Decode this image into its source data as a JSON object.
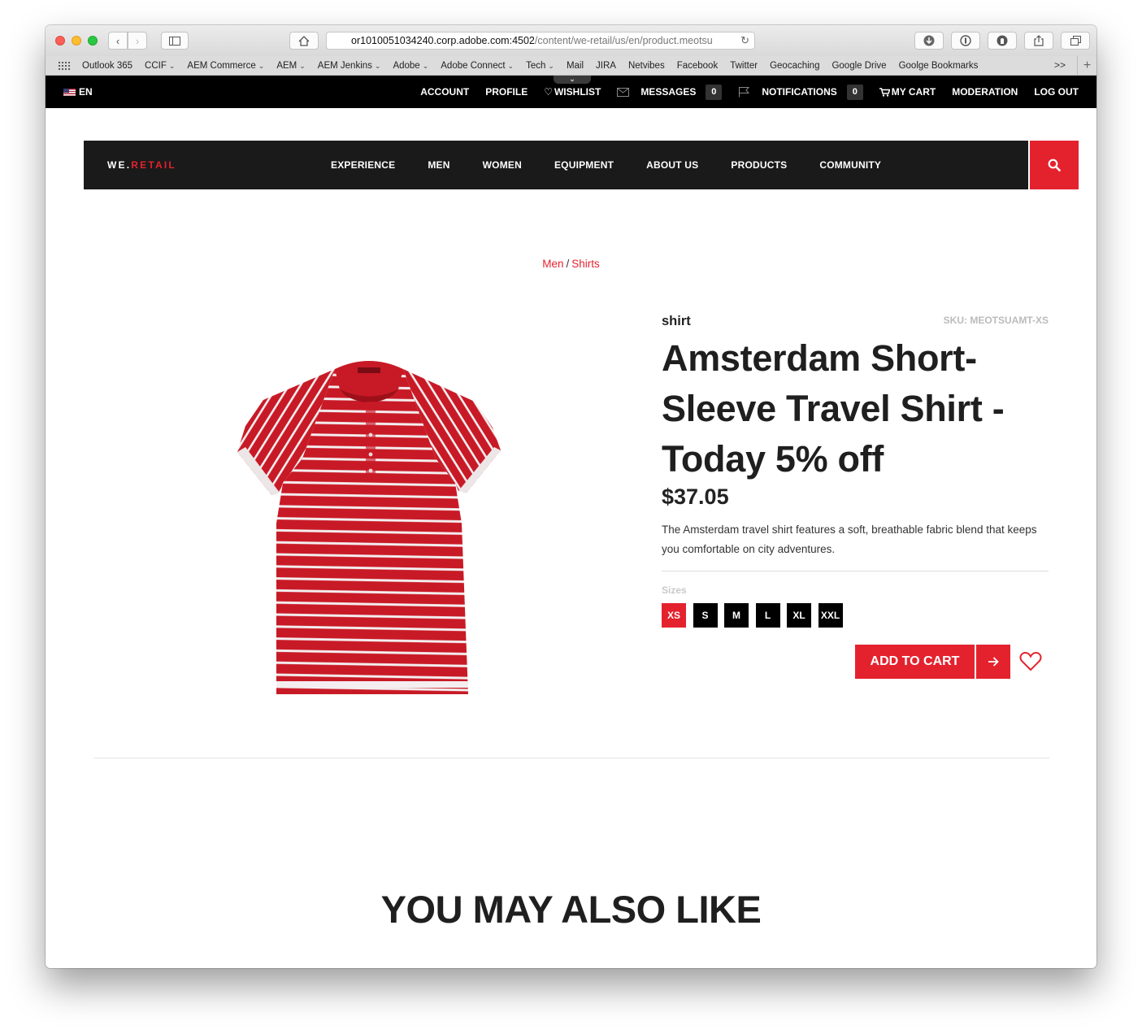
{
  "browser": {
    "url_host": "or1010051034240.corp.adobe.com:4502",
    "url_path": "/content/we-retail/us/en/product.meotsu",
    "bookmarks": [
      {
        "label": "Outlook 365",
        "has_menu": false
      },
      {
        "label": "CCIF",
        "has_menu": true
      },
      {
        "label": "AEM Commerce",
        "has_menu": true
      },
      {
        "label": "AEM",
        "has_menu": true
      },
      {
        "label": "AEM Jenkins",
        "has_menu": true
      },
      {
        "label": "Adobe",
        "has_menu": true
      },
      {
        "label": "Adobe Connect",
        "has_menu": true
      },
      {
        "label": "Tech",
        "has_menu": true
      },
      {
        "label": "Mail",
        "has_menu": false
      },
      {
        "label": "JIRA",
        "has_menu": false
      },
      {
        "label": "Netvibes",
        "has_menu": false
      },
      {
        "label": "Facebook",
        "has_menu": false
      },
      {
        "label": "Twitter",
        "has_menu": false
      },
      {
        "label": "Geocaching",
        "has_menu": false
      },
      {
        "label": "Google Drive",
        "has_menu": false
      },
      {
        "label": "Goolge Bookmarks",
        "has_menu": false
      }
    ],
    "bookmarks_more": ">>"
  },
  "utility": {
    "language": "EN",
    "account": "ACCOUNT",
    "profile": "PROFILE",
    "wishlist": "WISHLIST",
    "messages": "MESSAGES",
    "messages_count": "0",
    "notifications": "NOTIFICATIONS",
    "notifications_count": "0",
    "cart": "MY CART",
    "moderation": "MODERATION",
    "logout": "LOG OUT"
  },
  "brand": {
    "prefix": "WE.",
    "name": "RETAIL",
    "accent_color": "#e4222e"
  },
  "nav": [
    "EXPERIENCE",
    "MEN",
    "WOMEN",
    "EQUIPMENT",
    "ABOUT US",
    "PRODUCTS",
    "COMMUNITY"
  ],
  "breadcrumb": {
    "level1": "Men",
    "separator": "/",
    "level2": "Shirts"
  },
  "product": {
    "category": "shirt",
    "sku": "SKU: MEOTSUAMT-XS",
    "title": "Amsterdam Short-Sleeve Travel Shirt - Today 5% off",
    "price": "$37.05",
    "description": "The Amsterdam travel shirt features a soft, breathable fabric blend that keeps you comfortable on city adventures.",
    "sizes_label": "Sizes",
    "sizes": [
      "XS",
      "S",
      "M",
      "L",
      "XL",
      "XXL"
    ],
    "selected_size": "XS",
    "add_to_cart": "ADD TO CART"
  },
  "recommendations": {
    "heading": "YOU MAY ALSO LIKE"
  }
}
